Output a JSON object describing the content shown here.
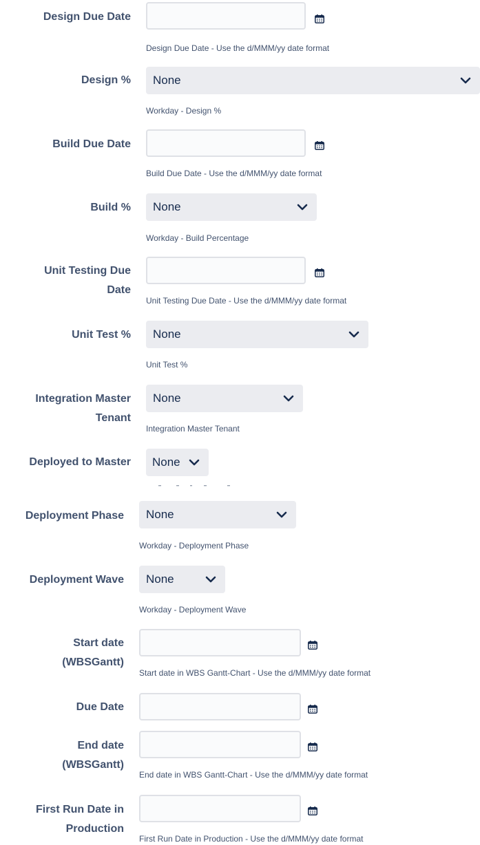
{
  "fields": [
    {
      "label": "Design Due Date",
      "help": "Design Due Date - Use the d/MMM/yy date format"
    },
    {
      "label": "Design %",
      "value": "None",
      "help": "Workday - Design %"
    },
    {
      "label": "Build Due Date",
      "help": "Build Due Date - Use the d/MMM/yy date format"
    },
    {
      "label": "Build %",
      "value": "None",
      "help": "Workday - Build Percentage"
    },
    {
      "label_line1": "Unit Testing Due",
      "label_line2": "Date",
      "help": "Unit Testing Due Date - Use the d/MMM/yy date format"
    },
    {
      "label": "Unit Test %",
      "value": "None",
      "help": "Unit Test %"
    },
    {
      "label_line1": "Integration Master",
      "label_line2": "Tenant",
      "value": "None",
      "help": "Integration Master Tenant"
    },
    {
      "label": "Deployed to Master",
      "value": "None"
    },
    {
      "label": "Deployment Phase",
      "value": "None",
      "help": "Workday - Deployment Phase"
    },
    {
      "label": "Deployment Wave",
      "value": "None",
      "help": "Workday - Deployment Wave"
    },
    {
      "label_line1": "Start date",
      "label_line2": "(WBSGantt)",
      "help": "Start date in WBS Gantt-Chart - Use the d/MMM/yy date format"
    },
    {
      "label": "Due Date"
    },
    {
      "label_line1": "End date",
      "label_line2": "(WBSGantt)",
      "help": "End date in WBS Gantt-Chart - Use the d/MMM/yy date format"
    },
    {
      "label_line1": "First Run Date in",
      "label_line2": "Production",
      "help": "First Run Date in Production - Use the d/MMM/yy date format"
    }
  ],
  "icons": {
    "calendar": "calendar-icon",
    "chevron": "chevron-down-icon"
  },
  "colors": {
    "label": "#42526e",
    "field_bg": "#ebecf0",
    "input_border": "#dfe1e6",
    "value": "#172b4d"
  }
}
